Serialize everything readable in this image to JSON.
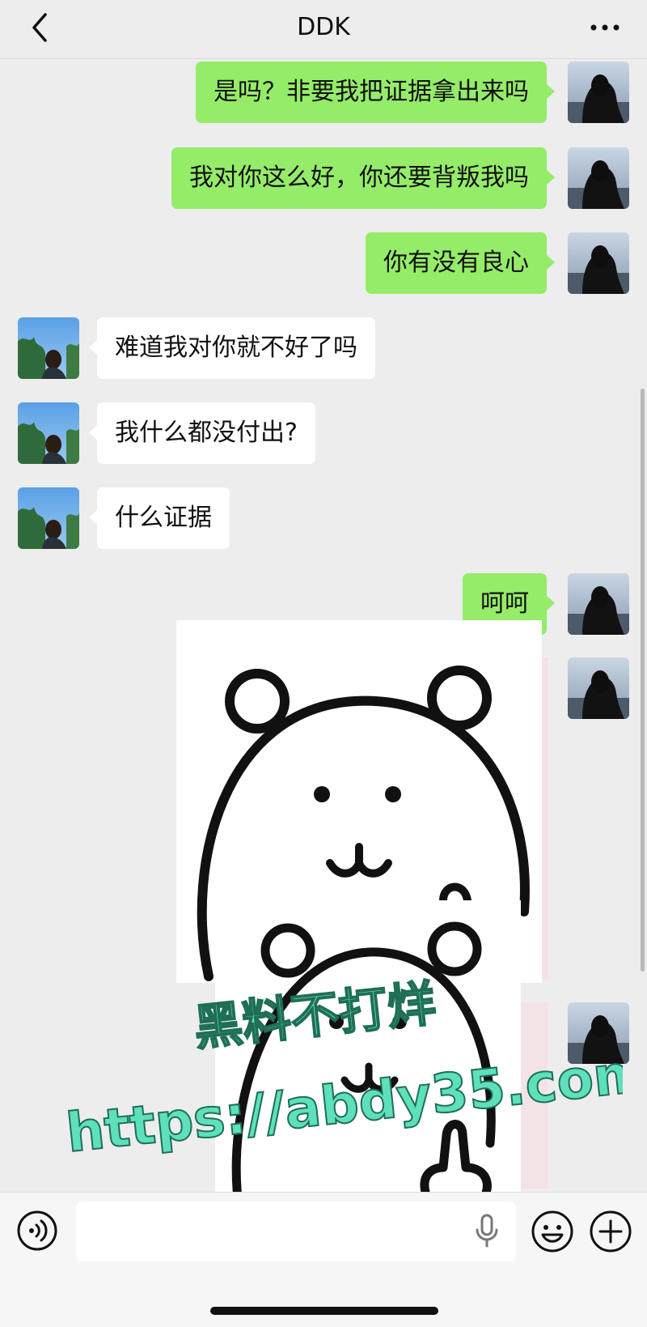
{
  "header": {
    "title": "DDK",
    "back_icon": "chevron-left-icon",
    "more_icon": "ellipsis-icon"
  },
  "messages": [
    {
      "side": "me",
      "text": "是吗？非要我把证据拿出来吗"
    },
    {
      "side": "me",
      "text": "我对你这么好，你还要背叛我吗"
    },
    {
      "side": "me",
      "text": "你有没有良心"
    },
    {
      "side": "them",
      "text": "难道我对你就不好了吗"
    },
    {
      "side": "them",
      "text": "我什么都没付出?"
    },
    {
      "side": "them",
      "text": "什么证据"
    },
    {
      "side": "me",
      "text": "呵呵"
    }
  ],
  "stickers": [
    {
      "side": "me",
      "description_icon": "bear-sticker"
    },
    {
      "side": "me",
      "description_icon": "bear-thumbs-up-sticker"
    }
  ],
  "watermark": {
    "line1": "黑料不打烊",
    "line2": "https://abdy35.com"
  },
  "input_bar": {
    "voice_icon": "voice-icon",
    "mic_icon": "mic-icon",
    "emoji_icon": "emoji-icon",
    "plus_icon": "plus-icon"
  },
  "colors": {
    "my_bubble": "#95ec69",
    "their_bubble": "#ffffff",
    "background": "#ededed",
    "watermark_fill": "#5ee0bd"
  }
}
